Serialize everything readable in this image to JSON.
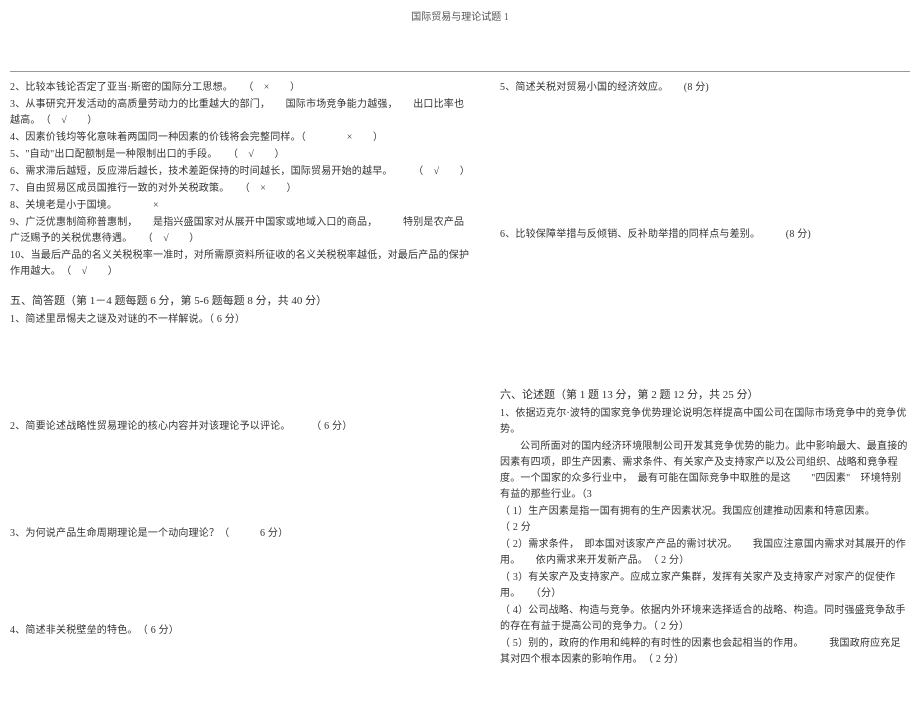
{
  "header": {
    "title": "国际贸易与理论试题 1"
  },
  "left": {
    "tf": {
      "q2": "2、比较本钱论否定了亚当·斯密的国际分工思想。　　（　×　　）",
      "q3": "3、从事研究开发活动的高质量劳动力的比重越大的部门，　　国际市场竞争能力越强，　　出口比率也越高。　（　√　　）",
      "q4": "4、因素价钱均等化意味着两国同一种因素的价钱将会完整同样。（　　　　×　　）",
      "q5": "5、\"自动\"出口配额制是一种限制出口的手段。　　（　√　　）",
      "q6": "6、需求滞后越短，反应滞后越长，技术差距保持的时间越长，国际贸易开始的越早。　　　（　√　　）",
      "q7": "7、自由贸易区成员国推行一致的对外关税政策。　　（　×　　）",
      "q8": "8、关境老是小于国境。　　　　×",
      "q9": "9、广泛优惠制简称普惠制，　　是指兴盛国家对从展开中国家或地域入口的商品，　　　特别是农产品广泛赐予的关税优惠待遇。　　（　√　　）",
      "q10": "10、当最后产品的名义关税税率一准时，对所需原资料所征收的名义关税税率越低，对最后产品的保护作用越大。　（　√　　）"
    },
    "section5": {
      "title": "五、简答题（第 1－4 题每题 6 分，第 5-6 题每题 8 分，共 40 分）",
      "q1": "1、简述里昂惕夫之谜及对谜的不一样解说。（ 6 分）",
      "q2": "2、简要论述战略性贸易理论的核心内容并对该理论予以评论。　　　（ 6 分）",
      "q3": "3、为何说产品生命周期理论是一个动向理论？（　　　6 分）",
      "q4": "4、简述非关税壁垒的特色。　（ 6 分）"
    }
  },
  "right": {
    "q5": "5、简述关税对贸易小国的经济效应。　　(8 分)",
    "q6": "6、比较保障举措与反倾销、反补助举措的同样点与差别。　　　(8 分)",
    "section6": {
      "title": "六、论述题（第  1 题 13 分，第 2 题 12 分，共 25 分）",
      "q1_intro": "1、依据迈克尔·波特的国家竞争优势理论说明怎样提高中国公司在国际市场竞争中的竞争优势。",
      "q1_body1": "公司所面对的国内经济环境限制公司开发其竞争优势的能力。此中影响最大、最直接的因素有四项，即生产因素、需求条件、有关家产及支持家产以及公司组织、战略和竟争程度。一个国家的众多行业中，　最有可能在国际竞争中取胜的是这　　\"四因素\"　环境特别有益的那些行业。（3",
      "q1_p1": "（ 1）生产因素是指一国有拥有的生产因素状况。我国应创建推动因素和特意因素。　　　　（ 2 分",
      "q1_p2": "（ 2）需求条件，　即本国对该家产产品的需讨状况。　　我国应注意国内需求对其展开的作用。　　依内需求来开发新产品。　（ 2 分）",
      "q1_p3": "（ 3）有关家产及支持家产。应成立家产集群，发挥有关家产及支持家产对家产的促使作用。　　（分）",
      "q1_p4": "（ 4）公司战略、构造与竞争。依据内外环境来选择适合的战略、构造。同时强盛竞争敌手的存在有益于提高公司的竞争力。（ 2 分）",
      "q1_p5": "（ 5）别的，政府的作用和纯粹的有时性的因素也会起相当的作用。　　　我国政府应充足其对四个根本因素的影响作用。　（ 2 分）"
    }
  }
}
